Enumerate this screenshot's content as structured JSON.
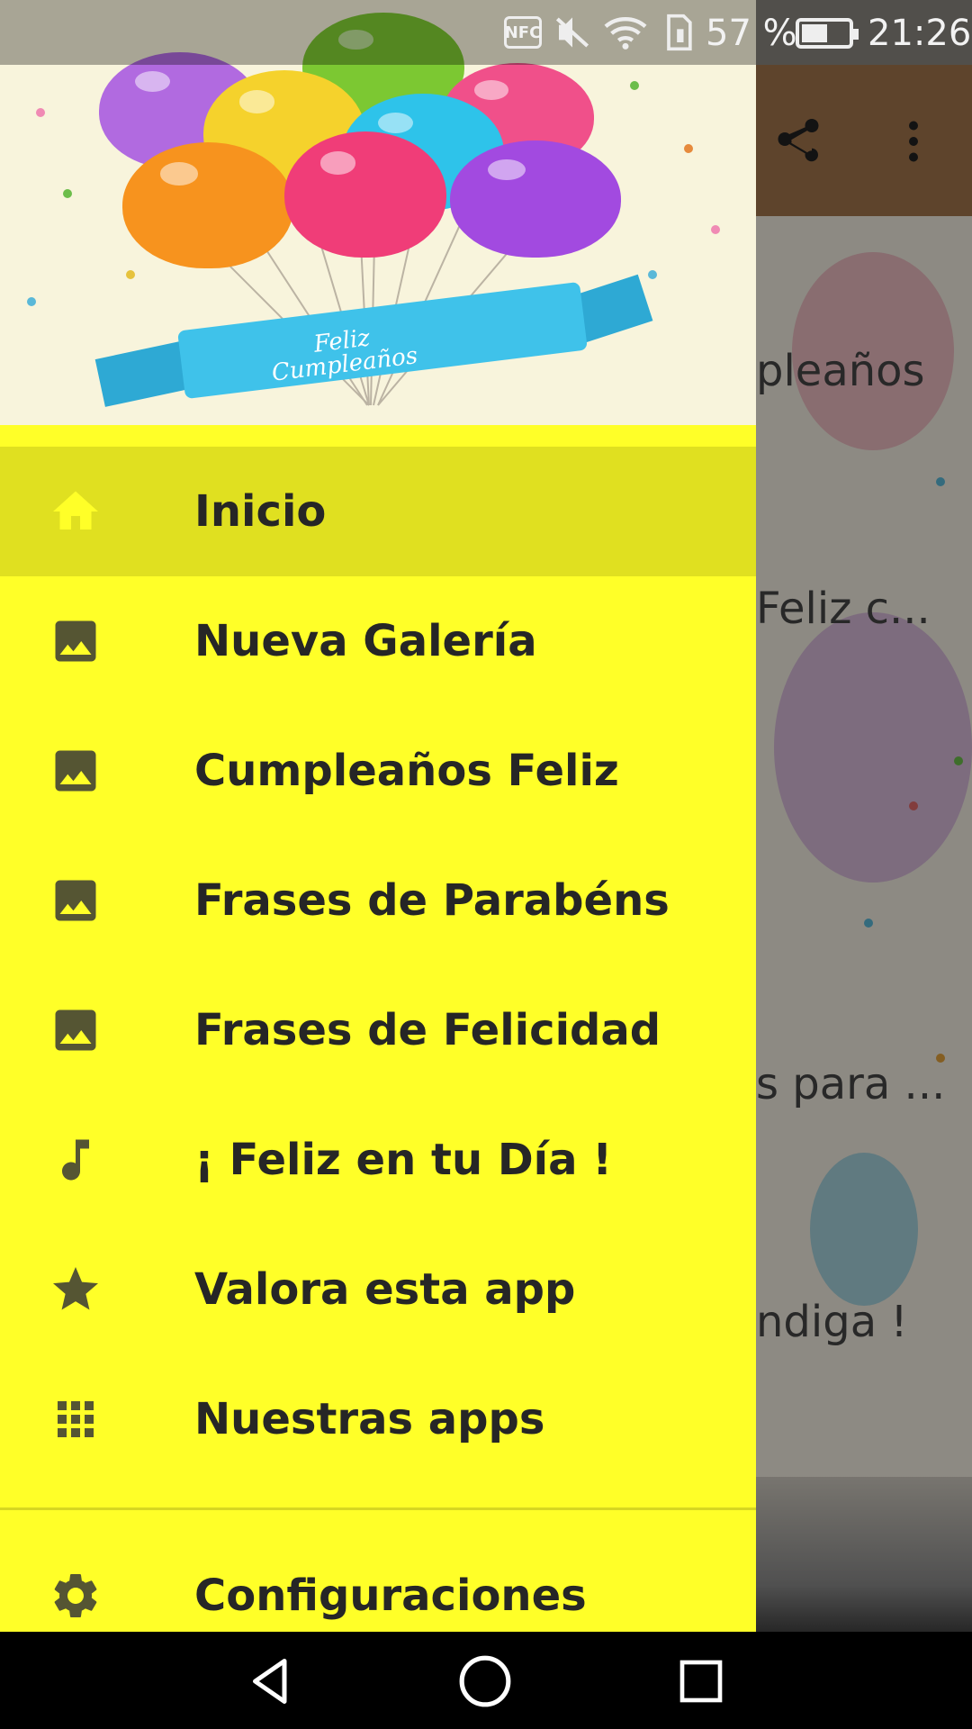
{
  "status_bar": {
    "nfc": "NFC",
    "battery_percent": "57 %",
    "time": "21:26",
    "icons": [
      "nfc-icon",
      "mute-icon",
      "wifi-icon",
      "sim-icon",
      "battery-icon"
    ]
  },
  "background_app": {
    "visible_text_fragments": [
      "pleaños",
      "Feliz c...",
      "s para ...",
      "ndiga !"
    ],
    "toolbar_icons": [
      "share-icon",
      "more-vert-icon"
    ],
    "toolbar_color": "#a3764c"
  },
  "drawer": {
    "header_image": {
      "ribbon_line1": "Feliz",
      "ribbon_line2": "Cumpleaños"
    },
    "background_color": "#ffff28",
    "active_color": "#e0e020",
    "items": [
      {
        "label": "Inicio",
        "icon": "home-icon",
        "active": true
      },
      {
        "label": "Nueva Galería",
        "icon": "image-icon",
        "active": false
      },
      {
        "label": "Cumpleaños Feliz",
        "icon": "image-icon",
        "active": false
      },
      {
        "label": "Frases de Parabéns",
        "icon": "image-icon",
        "active": false
      },
      {
        "label": "Frases de Felicidad",
        "icon": "image-icon",
        "active": false
      },
      {
        "label": "¡ Feliz en tu Día !",
        "icon": "music-note-icon",
        "active": false
      },
      {
        "label": "Valora esta app",
        "icon": "star-icon",
        "active": false
      },
      {
        "label": "Nuestras apps",
        "icon": "apps-grid-icon",
        "active": false
      }
    ],
    "settings": {
      "label": "Configuraciones",
      "icon": "gear-icon"
    }
  },
  "nav_bar": {
    "buttons": [
      "back-icon",
      "home-circle-icon",
      "recents-icon"
    ]
  }
}
